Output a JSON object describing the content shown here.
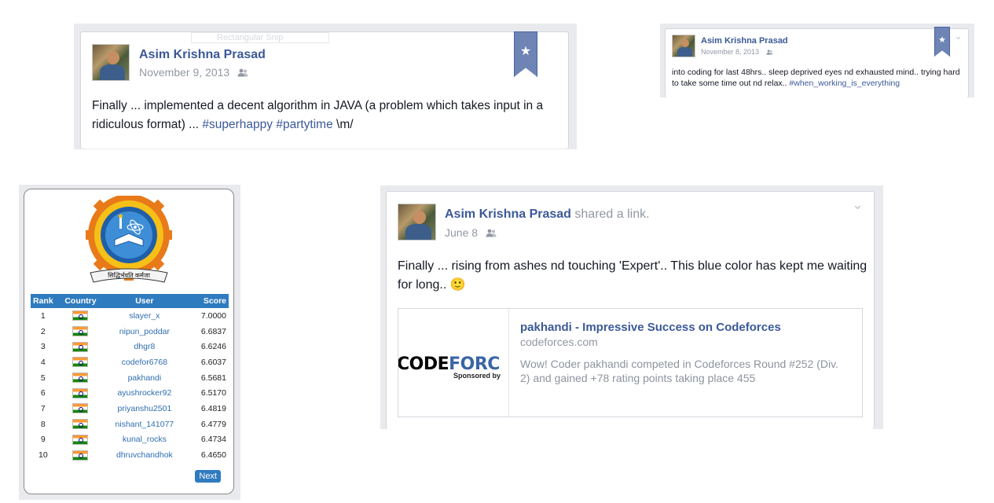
{
  "posts": {
    "post1": {
      "author": "Asim Krishna Prasad",
      "date": "November 9, 2013",
      "text_plain": "Finally ... implemented a decent algorithm in JAVA (a problem which takes input in a ridiculous format) ... ",
      "tags": "#superhappy #partytime",
      "text_end": " \\m/",
      "ghost_label": "Rectangular Snip"
    },
    "post2": {
      "author": "Asim Krishna Prasad",
      "date": "November 8, 2013",
      "text_plain": "into coding for last 48hrs.. sleep deprived eyes nd exhausted mind.. trying hard to take some time out nd relax.. ",
      "tag": "#when_working_is_everything"
    },
    "post3": {
      "author": "Asim Krishna Prasad",
      "action": " shared a link.",
      "date": "June 8",
      "text": "Finally ... rising from ashes nd touching 'Expert'.. This blue color has kept me waiting for long.. 🙂",
      "link": {
        "title": "pakhandi - Impressive Success on Codeforces",
        "domain": "codeforces.com",
        "description": "Wow! Coder pakhandi competed in Codeforces Round #252 (Div. 2) and gained +78 rating points taking place 455",
        "thumb_logo_a": "CODE",
        "thumb_logo_b": "FORC",
        "thumb_sub": "Sponsored by"
      }
    }
  },
  "leaderboard": {
    "motto": "सिद्धिर्भवति कर्मजा",
    "headers": [
      "Rank",
      "Country",
      "User",
      "Score"
    ],
    "rows": [
      {
        "rank": "1",
        "user": "slayer_x",
        "score": "7.0000"
      },
      {
        "rank": "2",
        "user": "nipun_poddar",
        "score": "6.6837"
      },
      {
        "rank": "3",
        "user": "dhgr8",
        "score": "6.6246"
      },
      {
        "rank": "4",
        "user": "codefor6768",
        "score": "6.6037"
      },
      {
        "rank": "5",
        "user": "pakhandi",
        "score": "6.5681"
      },
      {
        "rank": "6",
        "user": "ayushrocker92",
        "score": "6.5170"
      },
      {
        "rank": "7",
        "user": "priyanshu2501",
        "score": "6.4819"
      },
      {
        "rank": "8",
        "user": "nishant_141077",
        "score": "6.4779"
      },
      {
        "rank": "9",
        "user": "kunal_rocks",
        "score": "6.4734"
      },
      {
        "rank": "10",
        "user": "dhruvchandhok",
        "score": "6.4650"
      }
    ],
    "next_label": "Next"
  },
  "icons": {
    "star": "★",
    "chevron": "⌄",
    "audience": "friends-icon"
  },
  "colors": {
    "link_blue": "#3b5998",
    "meta_gray": "#9197a3",
    "ribbon": "#6d84b4",
    "table_header": "#2f7bbf"
  }
}
